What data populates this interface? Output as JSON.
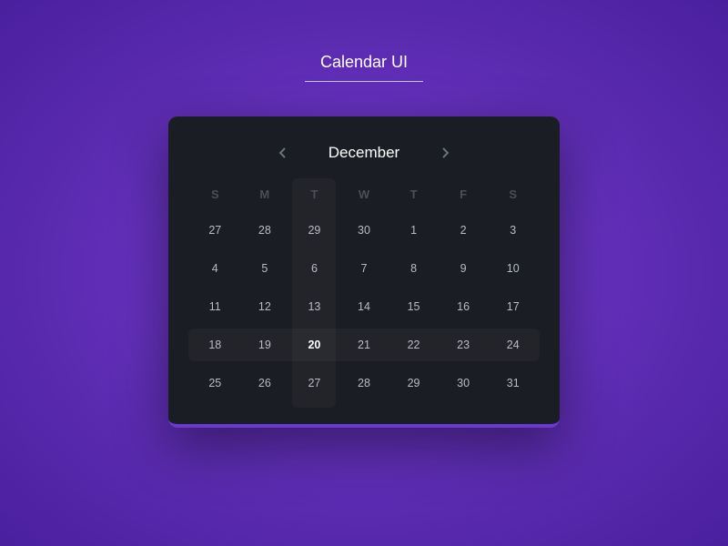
{
  "page_title": "Calendar UI",
  "month": "December",
  "day_headers": [
    "S",
    "M",
    "T",
    "W",
    "T",
    "F",
    "S"
  ],
  "highlight_col_index": 2,
  "highlight_row_index": 3,
  "selected_date": 20,
  "weeks": [
    [
      {
        "d": 27,
        "muted": true
      },
      {
        "d": 28,
        "muted": true
      },
      {
        "d": 29,
        "muted": true
      },
      {
        "d": 30,
        "muted": true
      },
      {
        "d": 1
      },
      {
        "d": 2
      },
      {
        "d": 3
      }
    ],
    [
      {
        "d": 4
      },
      {
        "d": 5
      },
      {
        "d": 6
      },
      {
        "d": 7
      },
      {
        "d": 8
      },
      {
        "d": 9
      },
      {
        "d": 10
      }
    ],
    [
      {
        "d": 11
      },
      {
        "d": 12
      },
      {
        "d": 13
      },
      {
        "d": 14
      },
      {
        "d": 15
      },
      {
        "d": 16
      },
      {
        "d": 17
      }
    ],
    [
      {
        "d": 18
      },
      {
        "d": 19
      },
      {
        "d": 20,
        "selected": true
      },
      {
        "d": 21
      },
      {
        "d": 22
      },
      {
        "d": 23
      },
      {
        "d": 24
      }
    ],
    [
      {
        "d": 25
      },
      {
        "d": 26
      },
      {
        "d": 27
      },
      {
        "d": 28
      },
      {
        "d": 29
      },
      {
        "d": 30
      },
      {
        "d": 31
      }
    ]
  ]
}
